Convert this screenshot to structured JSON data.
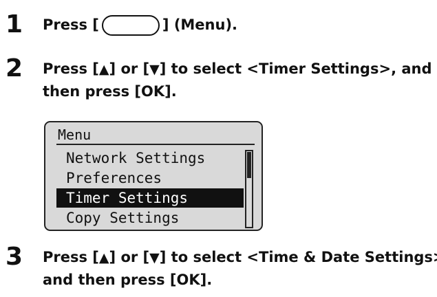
{
  "steps": [
    {
      "number": "1",
      "line1_before": "Press [",
      "line1_after": "] (Menu)."
    },
    {
      "number": "2",
      "line1_part1": "Press [",
      "up_arrow": "▲",
      "line1_part2": "] or [",
      "down_arrow": "▼",
      "line1_part3": "] to select <Timer Settings>, and",
      "line2": "then press [OK]."
    },
    {
      "number": "3",
      "line1_part1": "Press [",
      "up_arrow": "▲",
      "line1_part2": "] or [",
      "down_arrow": "▼",
      "line1_part3": "] to select <Time & Date Settings>,",
      "line2": "and then press [OK]."
    }
  ],
  "lcd": {
    "title": "Menu",
    "items": [
      "Network Settings",
      "Preferences",
      "Timer Settings",
      "Copy Settings"
    ],
    "selected_index": 2,
    "scroll_fraction_visible": 0.35
  },
  "colors": {
    "lcd_background": "#d9d9d9",
    "selection_background": "#111111",
    "text": "#111111"
  }
}
